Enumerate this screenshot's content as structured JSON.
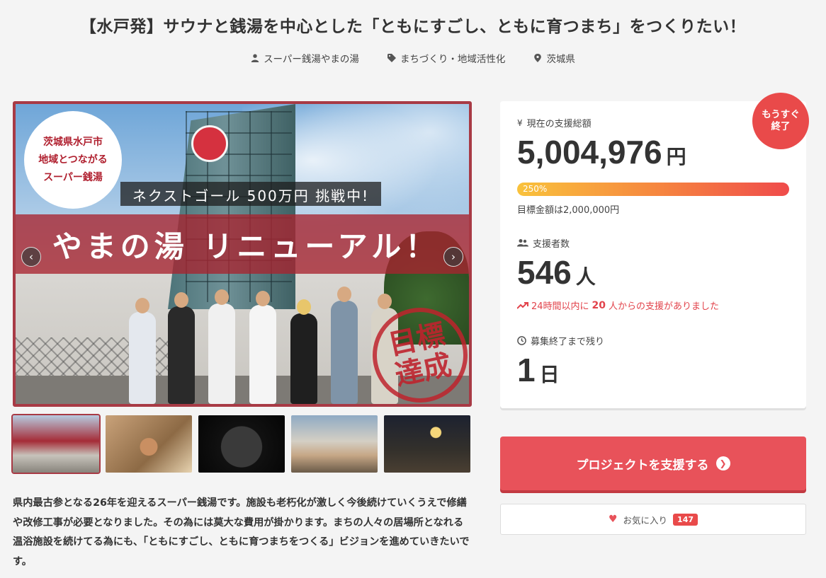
{
  "project": {
    "title": "【水戸発】サウナと銭湯を中心とした「ともにすごし、ともに育つまち」をつくりたい！",
    "owner": "スーパー銭湯やまの湯",
    "category": "まちづくり・地域活性化",
    "location": "茨城県"
  },
  "hero": {
    "badge_lines": [
      "茨城県水戸市",
      "地域とつながる",
      "スーパー銭湯"
    ],
    "goal_banner": "ネクストゴール 500万円 挑戦中!",
    "band_text": "やまの湯 リニューアル！",
    "stamp_lines": [
      "目標",
      "達成"
    ],
    "prev_icon": "chevron-left-icon",
    "next_icon": "chevron-right-icon"
  },
  "thumbnails": [
    {
      "name": "thumb-renewal-banner"
    },
    {
      "name": "thumb-owner-portrait"
    },
    {
      "name": "thumb-sauna-stones"
    },
    {
      "name": "thumb-meeting"
    },
    {
      "name": "thumb-night-event"
    }
  ],
  "description": "県内最古参となる26年を迎えるスーパー銭湯です。施設も老朽化が激しく今後続けていくうえで修繕や改修工事が必要となりました。その為には莫大な費用が掛かります。まちの人々の居場所となれる温浴施設を続けてる為にも、「ともにすごし、ともに育つまちをつくる」ビジョンを進めていきたいです。",
  "stats": {
    "soon_badge": [
      "もうすぐ",
      "終了"
    ],
    "amount_label": "現在の支援総額",
    "amount_icon": "yen-icon",
    "amount_value": "5,004,976",
    "amount_unit": "円",
    "progress_percent_label": "250%",
    "progress_fraction": 1.0,
    "goal_text": "目標金額は2,000,000円",
    "supporters_label": "支援者数",
    "supporters_value": "546",
    "supporters_unit": "人",
    "trend_prefix": "24時間以内に",
    "trend_count": "20",
    "trend_suffix": "人からの支援がありました",
    "remaining_label": "募集終了まで残り",
    "remaining_value": "1",
    "remaining_unit": "日"
  },
  "actions": {
    "support_label": "プロジェクトを支援する",
    "favorite_label": "お気に入り",
    "favorite_count": "147"
  },
  "colors": {
    "accent": "#e8525a",
    "badge": "#e94a4a",
    "hero_border": "#a83a45"
  }
}
